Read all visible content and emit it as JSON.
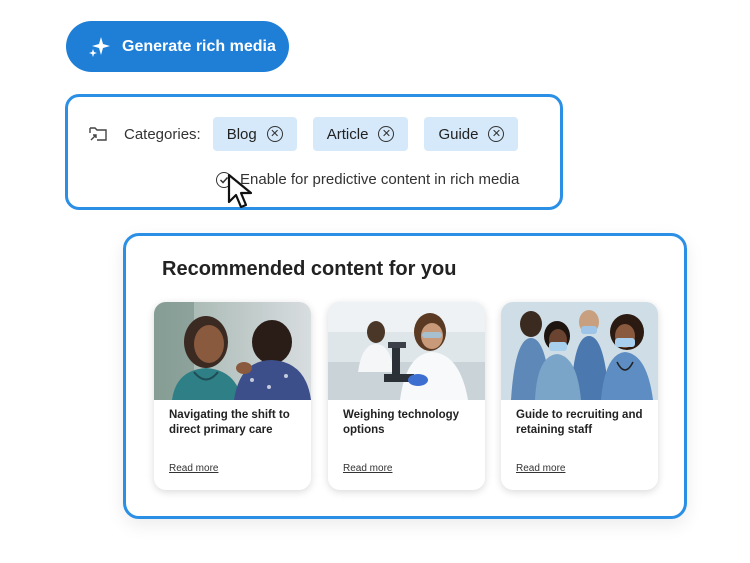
{
  "generate_button": {
    "label": "Generate rich media",
    "icon": "sparkle-icon"
  },
  "categories": {
    "label": "Categories:",
    "icon": "folder-link-icon",
    "tags": [
      {
        "label": "Blog"
      },
      {
        "label": "Article"
      },
      {
        "label": "Guide"
      }
    ],
    "predictive_checkbox": {
      "label": "Enable for predictive content in rich media",
      "checked": true
    }
  },
  "recommended": {
    "title": "Recommended content for you",
    "cards": [
      {
        "title": "Navigating the shift to direct primary care",
        "link": "Read more",
        "image": "doctor-consulting-patient-photo"
      },
      {
        "title": "Weighing technology options",
        "link": "Read more",
        "image": "lab-scientist-microscope-photo"
      },
      {
        "title": "Guide to recruiting and retaining staff",
        "link": "Read more",
        "image": "medical-team-masks-photo"
      }
    ]
  },
  "colors": {
    "accent": "#1f7fd6",
    "panel_border": "#2b8fe6",
    "tag_bg": "#d5e9fa"
  }
}
